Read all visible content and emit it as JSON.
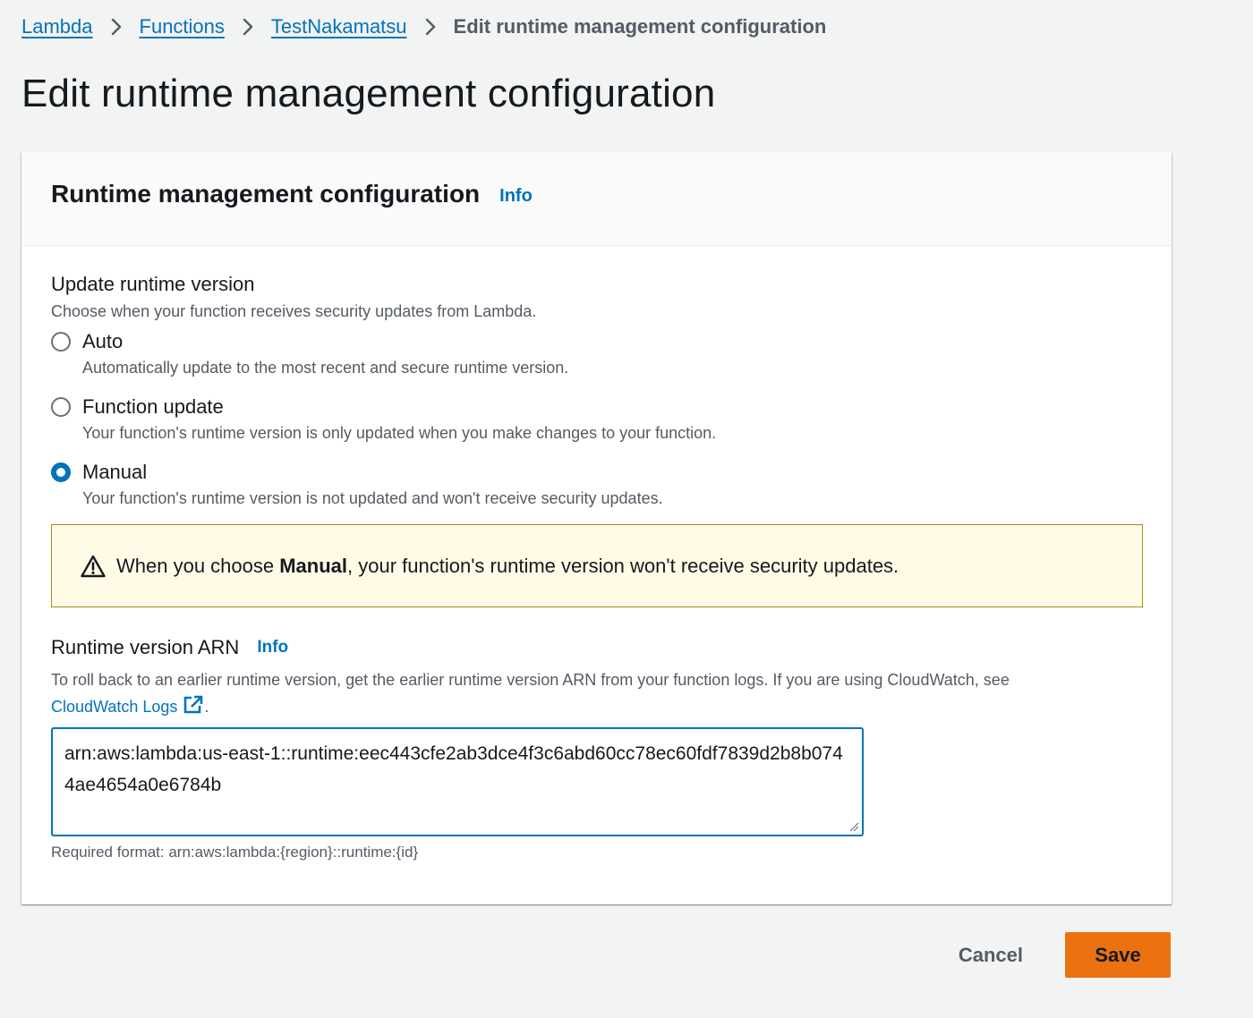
{
  "breadcrumb": {
    "items": [
      "Lambda",
      "Functions",
      "TestNakamatsu"
    ],
    "current": "Edit runtime management configuration"
  },
  "page": {
    "title": "Edit runtime management configuration"
  },
  "panel": {
    "title": "Runtime management configuration",
    "info_label": "Info"
  },
  "update_runtime": {
    "label": "Update runtime version",
    "description": "Choose when your function receives security updates from Lambda.",
    "selected": "Manual",
    "options": [
      {
        "label": "Auto",
        "description": "Automatically update to the most recent and secure runtime version."
      },
      {
        "label": "Function update",
        "description": "Your function's runtime version is only updated when you make changes to your function."
      },
      {
        "label": "Manual",
        "description": "Your function's runtime version is not updated and won't receive security updates."
      }
    ]
  },
  "alert": {
    "prefix": "When you choose ",
    "emphasis": "Manual",
    "suffix": ", your function's runtime version won't receive security updates."
  },
  "arn": {
    "label": "Runtime version ARN",
    "info_label": "Info",
    "description": "To roll back to an earlier runtime version, get the earlier runtime version ARN from your function logs. If you are using CloudWatch, see ",
    "link_text": "CloudWatch Logs",
    "description_end": ".",
    "value": "arn:aws:lambda:us-east-1::runtime:eec443cfe2ab3dce4f3c6abd60cc78ec60fdf7839d2b8b0744ae4654a0e6784b",
    "constraint": "Required format: arn:aws:lambda:{region}::runtime:{id}"
  },
  "actions": {
    "cancel": "Cancel",
    "save": "Save"
  },
  "colors": {
    "link": "#0073bb",
    "primary_button": "#ec7211",
    "warning_bg": "#fffbe6",
    "warning_border": "#ac8a1c"
  }
}
